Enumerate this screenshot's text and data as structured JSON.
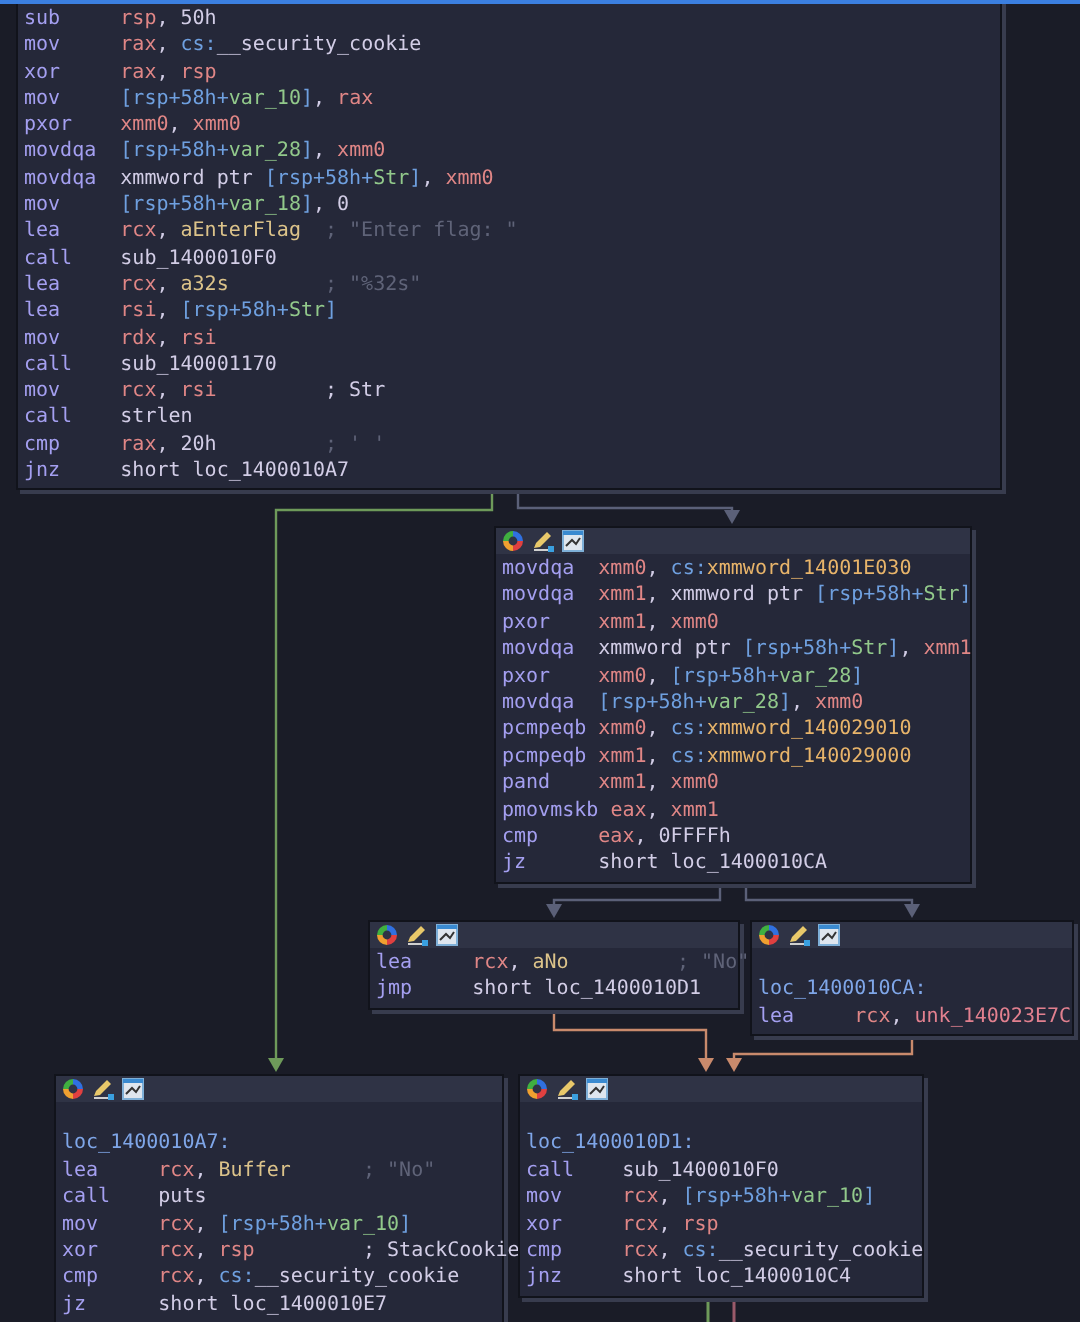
{
  "nodes": [
    {
      "toolbar": false,
      "lines": [
        {
          "kind": "insn",
          "mnemonic": "sub",
          "operands": [
            {
              "text": "rsp",
              "kind": "reg"
            },
            {
              "text": ", ",
              "kind": "punct"
            },
            {
              "text": "50h",
              "kind": "num"
            }
          ]
        },
        {
          "kind": "insn",
          "mnemonic": "mov",
          "operands": [
            {
              "text": "rax",
              "kind": "reg"
            },
            {
              "text": ", ",
              "kind": "punct"
            },
            {
              "text": "cs:",
              "kind": "mem"
            },
            {
              "text": "__security_cookie",
              "kind": "sym"
            }
          ]
        },
        {
          "kind": "insn",
          "mnemonic": "xor",
          "operands": [
            {
              "text": "rax",
              "kind": "reg"
            },
            {
              "text": ", ",
              "kind": "punct"
            },
            {
              "text": "rsp",
              "kind": "reg"
            }
          ]
        },
        {
          "kind": "insn",
          "mnemonic": "mov",
          "operands": [
            {
              "text": "[rsp+58h+",
              "kind": "mem"
            },
            {
              "text": "var_10",
              "kind": "var"
            },
            {
              "text": "]",
              "kind": "mem"
            },
            {
              "text": ", ",
              "kind": "punct"
            },
            {
              "text": "rax",
              "kind": "reg"
            }
          ]
        },
        {
          "kind": "insn",
          "mnemonic": "pxor",
          "operands": [
            {
              "text": "xmm0",
              "kind": "reg"
            },
            {
              "text": ", ",
              "kind": "punct"
            },
            {
              "text": "xmm0",
              "kind": "reg"
            }
          ]
        },
        {
          "kind": "insn",
          "mnemonic": "movdqa",
          "operands": [
            {
              "text": "[rsp+58h+",
              "kind": "mem"
            },
            {
              "text": "var_28",
              "kind": "var"
            },
            {
              "text": "]",
              "kind": "mem"
            },
            {
              "text": ", ",
              "kind": "punct"
            },
            {
              "text": "xmm0",
              "kind": "reg"
            }
          ]
        },
        {
          "kind": "insn",
          "mnemonic": "movdqa",
          "operands": [
            {
              "text": "xmmword ptr ",
              "kind": "sym"
            },
            {
              "text": "[rsp+58h+",
              "kind": "mem"
            },
            {
              "text": "Str",
              "kind": "var"
            },
            {
              "text": "]",
              "kind": "mem"
            },
            {
              "text": ", ",
              "kind": "punct"
            },
            {
              "text": "xmm0",
              "kind": "reg"
            }
          ]
        },
        {
          "kind": "insn",
          "mnemonic": "mov",
          "operands": [
            {
              "text": "[rsp+58h+",
              "kind": "mem"
            },
            {
              "text": "var_18",
              "kind": "var"
            },
            {
              "text": "]",
              "kind": "mem"
            },
            {
              "text": ", ",
              "kind": "punct"
            },
            {
              "text": "0",
              "kind": "num"
            }
          ]
        },
        {
          "kind": "insn",
          "mnemonic": "lea",
          "operands": [
            {
              "text": "rcx",
              "kind": "reg"
            },
            {
              "text": ", ",
              "kind": "punct"
            },
            {
              "text": "aEnterFlag",
              "kind": "data"
            }
          ],
          "comment": {
            "text": "; \"Enter flag: \"",
            "kind": "string"
          }
        },
        {
          "kind": "insn",
          "mnemonic": "call",
          "operands": [
            {
              "text": "sub_1400010F0",
              "kind": "sym"
            }
          ]
        },
        {
          "kind": "insn",
          "mnemonic": "lea",
          "operands": [
            {
              "text": "rcx",
              "kind": "reg"
            },
            {
              "text": ", ",
              "kind": "punct"
            },
            {
              "text": "a32s",
              "kind": "data"
            }
          ],
          "comment": {
            "text": "; \"%32s\"",
            "kind": "string"
          }
        },
        {
          "kind": "insn",
          "mnemonic": "lea",
          "operands": [
            {
              "text": "rsi",
              "kind": "reg"
            },
            {
              "text": ", ",
              "kind": "punct"
            },
            {
              "text": "[rsp+58h+",
              "kind": "mem"
            },
            {
              "text": "Str",
              "kind": "var"
            },
            {
              "text": "]",
              "kind": "mem"
            }
          ]
        },
        {
          "kind": "insn",
          "mnemonic": "mov",
          "operands": [
            {
              "text": "rdx",
              "kind": "reg"
            },
            {
              "text": ", ",
              "kind": "punct"
            },
            {
              "text": "rsi",
              "kind": "reg"
            }
          ]
        },
        {
          "kind": "insn",
          "mnemonic": "call",
          "operands": [
            {
              "text": "sub_140001170",
              "kind": "sym"
            }
          ]
        },
        {
          "kind": "insn",
          "mnemonic": "mov",
          "operands": [
            {
              "text": "rcx",
              "kind": "reg"
            },
            {
              "text": ", ",
              "kind": "punct"
            },
            {
              "text": "rsi",
              "kind": "reg"
            }
          ],
          "comment": {
            "text": "; Str",
            "kind": "name"
          }
        },
        {
          "kind": "insn",
          "mnemonic": "call",
          "operands": [
            {
              "text": "strlen",
              "kind": "sym"
            }
          ]
        },
        {
          "kind": "insn",
          "mnemonic": "cmp",
          "operands": [
            {
              "text": "rax",
              "kind": "reg"
            },
            {
              "text": ", ",
              "kind": "punct"
            },
            {
              "text": "20h",
              "kind": "num"
            }
          ],
          "comment": {
            "text": "; ' '",
            "kind": "string"
          }
        },
        {
          "kind": "insn",
          "mnemonic": "jnz",
          "operands": [
            {
              "text": "short loc_1400010A7",
              "kind": "sym"
            }
          ]
        }
      ]
    },
    {
      "toolbar": true,
      "lines": [
        {
          "kind": "insn",
          "mnemonic": "movdqa",
          "operands": [
            {
              "text": "xmm0",
              "kind": "reg"
            },
            {
              "text": ", ",
              "kind": "punct"
            },
            {
              "text": "cs:",
              "kind": "mem"
            },
            {
              "text": "xmmword_14001E030",
              "kind": "xmm"
            }
          ]
        },
        {
          "kind": "insn",
          "mnemonic": "movdqa",
          "operands": [
            {
              "text": "xmm1",
              "kind": "reg"
            },
            {
              "text": ", ",
              "kind": "punct"
            },
            {
              "text": "xmmword ptr ",
              "kind": "sym"
            },
            {
              "text": "[rsp+58h+",
              "kind": "mem"
            },
            {
              "text": "Str",
              "kind": "var"
            },
            {
              "text": "]",
              "kind": "mem"
            }
          ]
        },
        {
          "kind": "insn",
          "mnemonic": "pxor",
          "operands": [
            {
              "text": "xmm1",
              "kind": "reg"
            },
            {
              "text": ", ",
              "kind": "punct"
            },
            {
              "text": "xmm0",
              "kind": "reg"
            }
          ]
        },
        {
          "kind": "insn",
          "mnemonic": "movdqa",
          "operands": [
            {
              "text": "xmmword ptr ",
              "kind": "sym"
            },
            {
              "text": "[rsp+58h+",
              "kind": "mem"
            },
            {
              "text": "Str",
              "kind": "var"
            },
            {
              "text": "]",
              "kind": "mem"
            },
            {
              "text": ", ",
              "kind": "punct"
            },
            {
              "text": "xmm1",
              "kind": "reg"
            }
          ]
        },
        {
          "kind": "insn",
          "mnemonic": "pxor",
          "operands": [
            {
              "text": "xmm0",
              "kind": "reg"
            },
            {
              "text": ", ",
              "kind": "punct"
            },
            {
              "text": "[rsp+58h+",
              "kind": "mem"
            },
            {
              "text": "var_28",
              "kind": "var"
            },
            {
              "text": "]",
              "kind": "mem"
            }
          ]
        },
        {
          "kind": "insn",
          "mnemonic": "movdqa",
          "operands": [
            {
              "text": "[rsp+58h+",
              "kind": "mem"
            },
            {
              "text": "var_28",
              "kind": "var"
            },
            {
              "text": "]",
              "kind": "mem"
            },
            {
              "text": ", ",
              "kind": "punct"
            },
            {
              "text": "xmm0",
              "kind": "reg"
            }
          ]
        },
        {
          "kind": "insn",
          "mnemonic": "pcmpeqb",
          "operands": [
            {
              "text": "xmm0",
              "kind": "reg"
            },
            {
              "text": ", ",
              "kind": "punct"
            },
            {
              "text": "cs:",
              "kind": "mem"
            },
            {
              "text": "xmmword_140029010",
              "kind": "xmm"
            }
          ]
        },
        {
          "kind": "insn",
          "mnemonic": "pcmpeqb",
          "operands": [
            {
              "text": "xmm1",
              "kind": "reg"
            },
            {
              "text": ", ",
              "kind": "punct"
            },
            {
              "text": "cs:",
              "kind": "mem"
            },
            {
              "text": "xmmword_140029000",
              "kind": "xmm"
            }
          ]
        },
        {
          "kind": "insn",
          "mnemonic": "pand",
          "operands": [
            {
              "text": "xmm1",
              "kind": "reg"
            },
            {
              "text": ", ",
              "kind": "punct"
            },
            {
              "text": "xmm0",
              "kind": "reg"
            }
          ]
        },
        {
          "kind": "insn",
          "mnemonic": "pmovmskb",
          "operands": [
            {
              "text": "eax",
              "kind": "reg"
            },
            {
              "text": ", ",
              "kind": "punct"
            },
            {
              "text": "xmm1",
              "kind": "reg"
            }
          ]
        },
        {
          "kind": "insn",
          "mnemonic": "cmp",
          "operands": [
            {
              "text": "eax",
              "kind": "reg"
            },
            {
              "text": ", ",
              "kind": "punct"
            },
            {
              "text": "0FFFFh",
              "kind": "num"
            }
          ]
        },
        {
          "kind": "insn",
          "mnemonic": "jz",
          "operands": [
            {
              "text": "short loc_1400010CA",
              "kind": "sym"
            }
          ]
        }
      ]
    },
    {
      "toolbar": true,
      "lines": [
        {
          "kind": "insn",
          "mnemonic": "lea",
          "operands": [
            {
              "text": "rcx",
              "kind": "reg"
            },
            {
              "text": ", ",
              "kind": "punct"
            },
            {
              "text": "aNo",
              "kind": "data"
            }
          ],
          "comment": {
            "text": "; \"No\"",
            "kind": "string"
          }
        },
        {
          "kind": "insn",
          "mnemonic": "jmp",
          "operands": [
            {
              "text": "short loc_1400010D1",
              "kind": "sym"
            }
          ]
        }
      ]
    },
    {
      "toolbar": true,
      "lines": [
        {
          "kind": "blank"
        },
        {
          "kind": "label",
          "text": "loc_1400010CA:"
        },
        {
          "kind": "insn",
          "mnemonic": "lea",
          "operands": [
            {
              "text": "rcx",
              "kind": "reg"
            },
            {
              "text": ", ",
              "kind": "punct"
            },
            {
              "text": "unk_140023E7C",
              "kind": "unk"
            }
          ]
        }
      ]
    },
    {
      "toolbar": true,
      "lines": [
        {
          "kind": "blank"
        },
        {
          "kind": "label",
          "text": "loc_1400010A7:"
        },
        {
          "kind": "insn",
          "mnemonic": "lea",
          "operands": [
            {
              "text": "rcx",
              "kind": "reg"
            },
            {
              "text": ", ",
              "kind": "punct"
            },
            {
              "text": "Buffer",
              "kind": "data"
            }
          ],
          "comment": {
            "text": "; \"No\"",
            "kind": "string"
          }
        },
        {
          "kind": "insn",
          "mnemonic": "call",
          "operands": [
            {
              "text": "puts",
              "kind": "sym"
            }
          ]
        },
        {
          "kind": "insn",
          "mnemonic": "mov",
          "operands": [
            {
              "text": "rcx",
              "kind": "reg"
            },
            {
              "text": ", ",
              "kind": "punct"
            },
            {
              "text": "[rsp+58h+",
              "kind": "mem"
            },
            {
              "text": "var_10",
              "kind": "var"
            },
            {
              "text": "]",
              "kind": "mem"
            }
          ]
        },
        {
          "kind": "insn",
          "mnemonic": "xor",
          "operands": [
            {
              "text": "rcx",
              "kind": "reg"
            },
            {
              "text": ", ",
              "kind": "punct"
            },
            {
              "text": "rsp",
              "kind": "reg"
            }
          ],
          "comment": {
            "text": "; StackCookie",
            "kind": "name"
          }
        },
        {
          "kind": "insn",
          "mnemonic": "cmp",
          "operands": [
            {
              "text": "rcx",
              "kind": "reg"
            },
            {
              "text": ", ",
              "kind": "punct"
            },
            {
              "text": "cs:",
              "kind": "mem"
            },
            {
              "text": "__security_cookie",
              "kind": "sym"
            }
          ]
        },
        {
          "kind": "insn",
          "mnemonic": "jz",
          "operands": [
            {
              "text": "short loc_1400010E7",
              "kind": "sym"
            }
          ]
        }
      ]
    },
    {
      "toolbar": true,
      "lines": [
        {
          "kind": "blank"
        },
        {
          "kind": "label",
          "text": "loc_1400010D1:"
        },
        {
          "kind": "insn",
          "mnemonic": "call",
          "operands": [
            {
              "text": "sub_1400010F0",
              "kind": "sym"
            }
          ]
        },
        {
          "kind": "insn",
          "mnemonic": "mov",
          "operands": [
            {
              "text": "rcx",
              "kind": "reg"
            },
            {
              "text": ", ",
              "kind": "punct"
            },
            {
              "text": "[rsp+58h+",
              "kind": "mem"
            },
            {
              "text": "var_10",
              "kind": "var"
            },
            {
              "text": "]",
              "kind": "mem"
            }
          ]
        },
        {
          "kind": "insn",
          "mnemonic": "xor",
          "operands": [
            {
              "text": "rcx",
              "kind": "reg"
            },
            {
              "text": ", ",
              "kind": "punct"
            },
            {
              "text": "rsp",
              "kind": "reg"
            }
          ]
        },
        {
          "kind": "insn",
          "mnemonic": "cmp",
          "operands": [
            {
              "text": "rcx",
              "kind": "reg"
            },
            {
              "text": ", ",
              "kind": "punct"
            },
            {
              "text": "cs:",
              "kind": "mem"
            },
            {
              "text": "__security_cookie",
              "kind": "sym"
            }
          ]
        },
        {
          "kind": "insn",
          "mnemonic": "jnz",
          "operands": [
            {
              "text": "short loc_1400010C4",
              "kind": "sym"
            }
          ]
        }
      ]
    }
  ],
  "edges": [
    {
      "color": "#6e9a5a"
    },
    {
      "color": "#5b6078"
    },
    {
      "color": "#5b6078"
    },
    {
      "color": "#5b6078"
    },
    {
      "color": "#c98a6c"
    },
    {
      "color": "#c98a6c"
    },
    {
      "color": "#6e9a5a"
    },
    {
      "color": "#9a5a6a"
    }
  ]
}
